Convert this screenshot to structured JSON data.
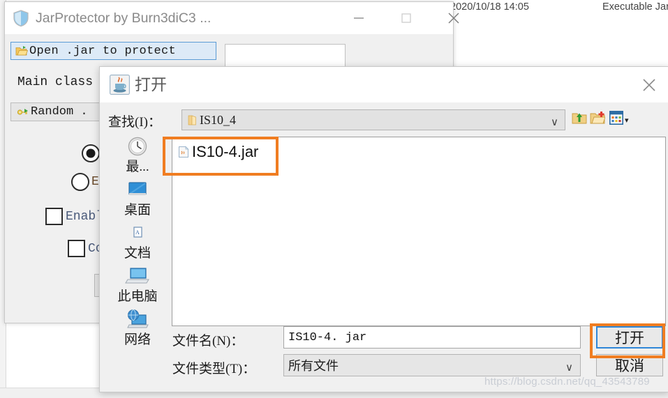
{
  "background": {
    "explorer_date": "2020/10/18 14:05",
    "explorer_type": "Executable Jar Fil"
  },
  "app_window": {
    "title": "JarProtector by Burn3diC3 ...",
    "icon": "shield-icon",
    "minimize_label": "—",
    "maximize_label": "□",
    "close_label": "✕",
    "open_jar_button": "Open .jar to protect",
    "jar_path_value": "",
    "main_class_label": "Main class",
    "random_button": "Random .",
    "radios": [
      {
        "label": "",
        "selected": true
      },
      {
        "label": "En",
        "selected": false
      }
    ],
    "checkboxes": [
      {
        "label": "Enabl",
        "checked": false
      },
      {
        "label": "Co",
        "checked": false
      }
    ]
  },
  "file_dialog": {
    "title": "打开",
    "icon": "java-coffee-icon",
    "close_label": "✕",
    "lookin_label": "查找(I)：",
    "lookin_value": "IS10_4",
    "lookin_arrow": "∨",
    "toolbar": [
      {
        "name": "up-folder-icon"
      },
      {
        "name": "new-folder-icon"
      },
      {
        "name": "view-mode-icon"
      }
    ],
    "toolbar_arrow": "▾",
    "places": [
      {
        "label": "最...",
        "icon": "recent-clock-icon"
      },
      {
        "label": "桌面",
        "icon": "desktop-icon"
      },
      {
        "label": "文档",
        "icon": "documents-icon"
      },
      {
        "label": "此电脑",
        "icon": "this-pc-icon"
      },
      {
        "label": "网络",
        "icon": "network-icon"
      }
    ],
    "files": [
      {
        "name": "IS10-4.jar",
        "icon": "jar-file-icon",
        "selected": true
      }
    ],
    "filename_label": "文件名(N)：",
    "filename_value": "IS10-4. jar",
    "filetype_label": "文件类型(T)：",
    "filetype_value": "所有文件",
    "filetype_arrow": "∨",
    "open_button": "打开",
    "cancel_button": "取消"
  },
  "annotations": {
    "color": "#f07d21",
    "highlight_file": "IS10-4.jar",
    "highlight_button": "打开"
  },
  "watermark": "https://blog.csdn.net/qq_43543789"
}
